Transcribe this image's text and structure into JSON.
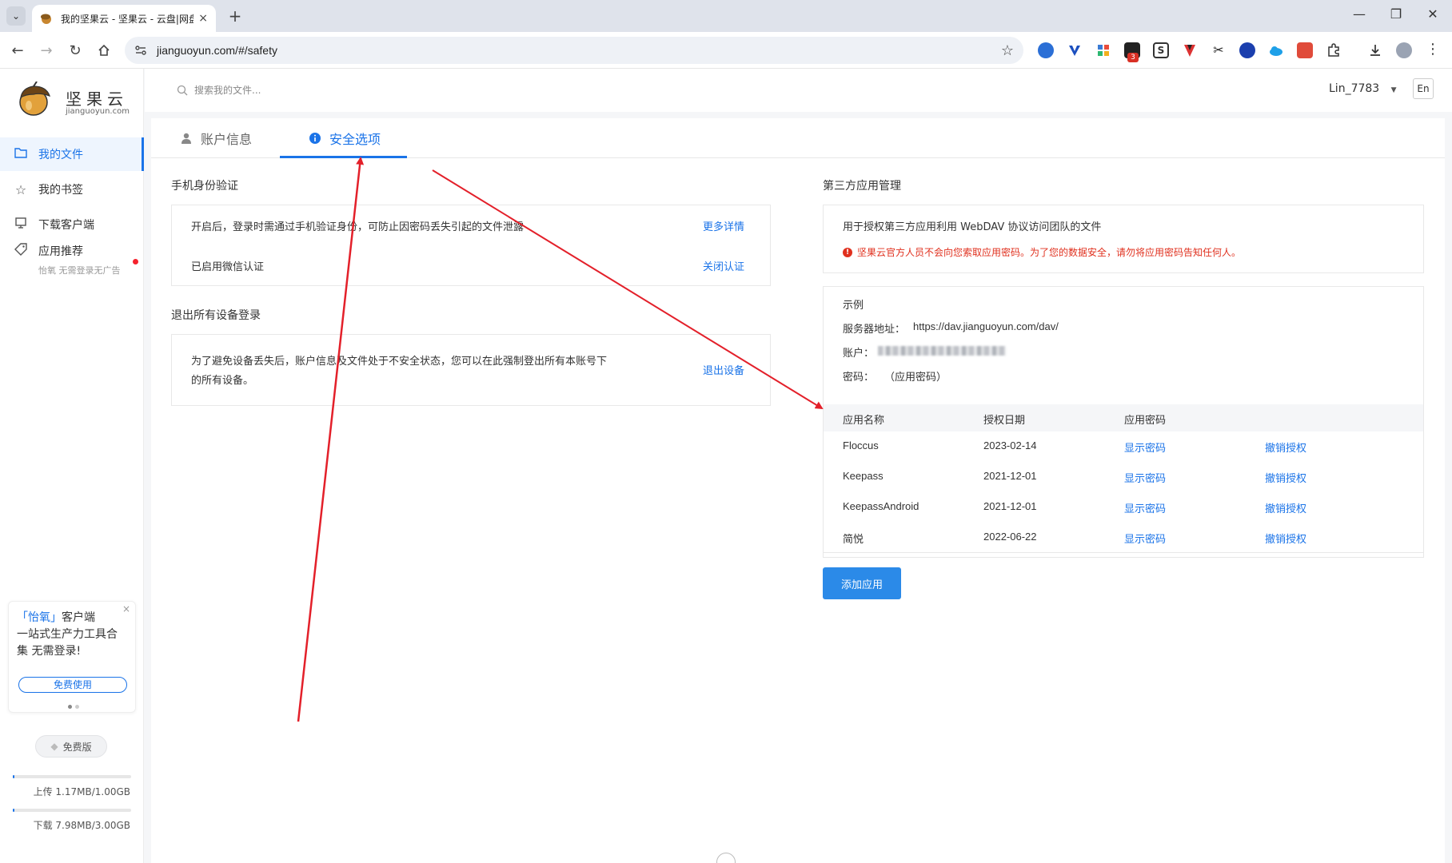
{
  "browser": {
    "tab_title": "我的坚果云 - 坚果云 - 云盘|网盘",
    "tab_close": "×",
    "new_tab": "+",
    "url": "jianguoyun.com/#/safety",
    "extension_badge": "3"
  },
  "sidebar": {
    "logo_cn": "坚果云",
    "logo_en": "jianguoyun.com",
    "items": [
      {
        "label": "我的文件"
      },
      {
        "label": "我的书签"
      },
      {
        "label": "下载客户端"
      },
      {
        "label": "应用推荐",
        "sub": "怡氧 无需登录无广告"
      }
    ],
    "promo": {
      "line_part1": "「怡氧」",
      "line_part2": "客户端",
      "line2": "一站式生产力工具合集 无需登录!",
      "button": "免费使用",
      "close": "×"
    },
    "plan": "免费版",
    "upload": {
      "text": "上传 1.17MB/1.00GB",
      "fraction": 0.0011
    },
    "download": {
      "text": "下载 7.98MB/3.00GB",
      "fraction": 0.0026
    }
  },
  "header": {
    "search_placeholder": "搜索我的文件...",
    "user": "Lin_7783",
    "lang": "En"
  },
  "tabs": [
    {
      "label": "账户信息"
    },
    {
      "label": "安全选项"
    }
  ],
  "phone_auth": {
    "title": "手机身份验证",
    "desc": "开启后，登录时需通过手机验证身份，可防止因密码丢失引起的文件泄露",
    "more": "更多详情",
    "status": "已启用微信认证",
    "disable": "关闭认证"
  },
  "logout_all": {
    "title": "退出所有设备登录",
    "desc_line1": "为了避免设备丢失后，账户信息及文件处于不安全状态，您可以在此强制登出所有本账号下",
    "desc_line2": "的所有设备。",
    "action": "退出设备"
  },
  "third_party": {
    "title": "第三方应用管理",
    "desc": "用于授权第三方应用利用 WebDAV 协议访问团队的文件",
    "warning": "坚果云官方人员不会向您索取应用密码。为了您的数据安全，请勿将应用密码告知任何人。",
    "example_title": "示例",
    "server_label": "服务器地址：",
    "server_value": "https://dav.jianguoyun.com/dav/",
    "account_label": "账户：",
    "password_label": "密码：",
    "password_value": "（应用密码）",
    "columns": [
      "应用名称",
      "授权日期",
      "应用密码"
    ],
    "rows": [
      {
        "name": "Floccus",
        "date": "2023-02-14",
        "show": "显示密码",
        "revoke": "撤销授权"
      },
      {
        "name": "Keepass",
        "date": "2021-12-01",
        "show": "显示密码",
        "revoke": "撤销授权"
      },
      {
        "name": "KeepassAndroid",
        "date": "2021-12-01",
        "show": "显示密码",
        "revoke": "撤销授权"
      },
      {
        "name": "简悦",
        "date": "2022-06-22",
        "show": "显示密码",
        "revoke": "撤销授权"
      }
    ],
    "add_button": "添加应用"
  },
  "colors": {
    "accent": "#1a73e8",
    "warning": "#e0301e",
    "annotation_arrow": "#e3202a"
  }
}
